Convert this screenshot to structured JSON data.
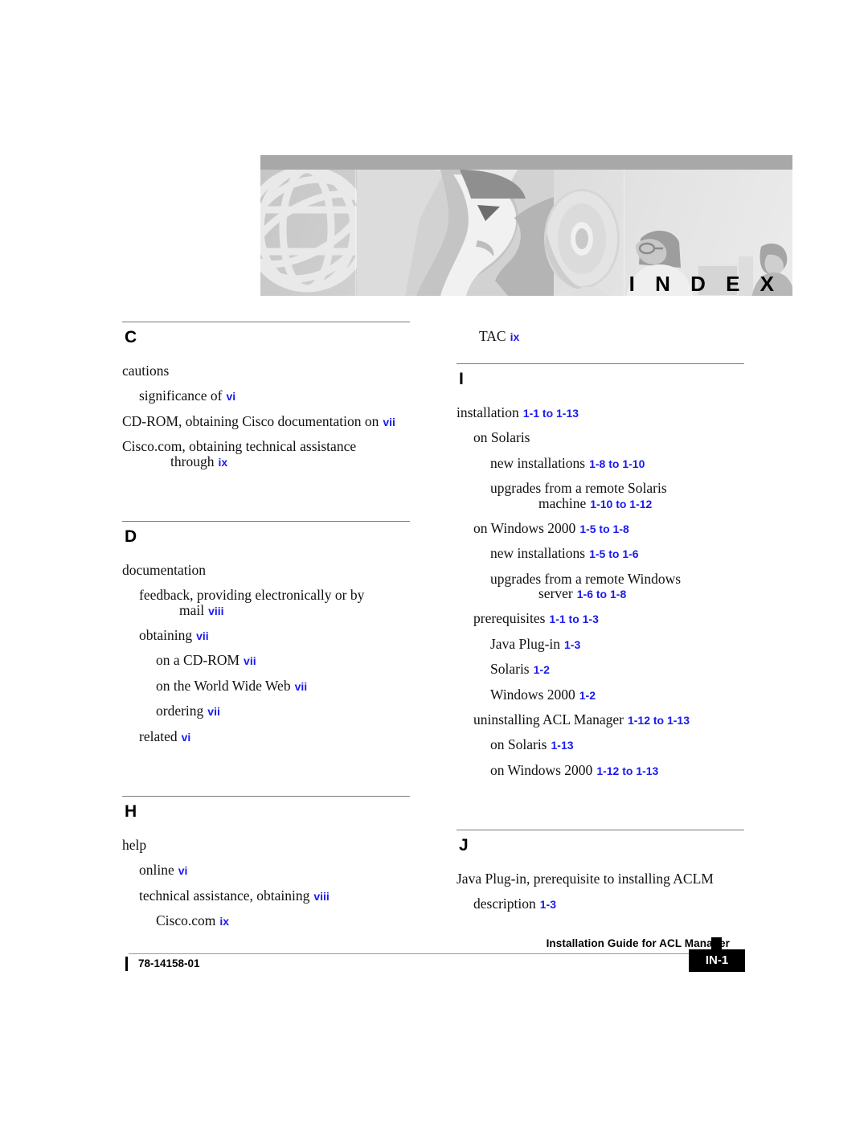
{
  "banner": {
    "title": "I N D E X",
    "icons": [
      "globe-wireframe",
      "stylized-face",
      "compact-disc",
      "people-at-monitor"
    ]
  },
  "orphan_entry": {
    "label": "TAC",
    "page": "ix"
  },
  "columns": {
    "left": [
      {
        "letter": "C",
        "entries": [
          {
            "level": 0,
            "text": "cautions",
            "page": ""
          },
          {
            "level": 1,
            "text": "significance of",
            "page": "vi"
          },
          {
            "level": 0,
            "text": "CD-ROM, obtaining Cisco documentation",
            "cont": "on",
            "page": "vii",
            "wrap": true
          },
          {
            "level": 0,
            "text": "Cisco.com, obtaining technical assistance",
            "cont": "through",
            "page": "ix",
            "wrap": true
          }
        ]
      },
      {
        "letter": "D",
        "entries": [
          {
            "level": 0,
            "text": "documentation",
            "page": ""
          },
          {
            "level": 1,
            "text": "feedback, providing electronically or by",
            "cont": "mail",
            "page": "viii",
            "wrap": true
          },
          {
            "level": 1,
            "text": "obtaining",
            "page": "vii"
          },
          {
            "level": 2,
            "text": "on a CD-ROM",
            "page": "vii"
          },
          {
            "level": 2,
            "text": "on the World Wide Web",
            "page": "vii"
          },
          {
            "level": 2,
            "text": "ordering",
            "page": "vii"
          },
          {
            "level": 1,
            "text": "related",
            "page": "vi"
          }
        ]
      },
      {
        "letter": "H",
        "entries": [
          {
            "level": 0,
            "text": "help",
            "page": ""
          },
          {
            "level": 1,
            "text": "online",
            "page": "vi"
          },
          {
            "level": 1,
            "text": "technical assistance, obtaining",
            "page": "viii"
          },
          {
            "level": 2,
            "text": "Cisco.com",
            "page": "ix"
          }
        ]
      }
    ],
    "right": [
      {
        "letter": "I",
        "entries": [
          {
            "level": 0,
            "text": "installation",
            "page": "1-1 to 1-13"
          },
          {
            "level": 1,
            "text": "on Solaris",
            "page": ""
          },
          {
            "level": 2,
            "text": "new installations",
            "page": "1-8 to 1-10"
          },
          {
            "level": 2,
            "text": "upgrades from a remote Solaris",
            "cont": "machine",
            "page": "1-10 to 1-12",
            "wrap": true
          },
          {
            "level": 1,
            "text": "on Windows 2000",
            "page": "1-5 to 1-8"
          },
          {
            "level": 2,
            "text": "new installations",
            "page": "1-5 to 1-6"
          },
          {
            "level": 2,
            "text": "upgrades from a remote Windows",
            "cont": "server",
            "page": "1-6 to 1-8",
            "wrap": true
          },
          {
            "level": 1,
            "text": "prerequisites",
            "page": "1-1 to 1-3"
          },
          {
            "level": 2,
            "text": "Java Plug-in",
            "page": "1-3"
          },
          {
            "level": 2,
            "text": "Solaris",
            "page": "1-2"
          },
          {
            "level": 2,
            "text": "Windows 2000",
            "page": "1-2"
          },
          {
            "level": 1,
            "text": "uninstalling ACL Manager",
            "page": "1-12 to 1-13"
          },
          {
            "level": 2,
            "text": "on Solaris",
            "page": "1-13"
          },
          {
            "level": 2,
            "text": "on Windows 2000",
            "page": "1-12 to 1-13"
          }
        ]
      },
      {
        "letter": "J",
        "entries": [
          {
            "level": 0,
            "text": "Java Plug-in, prerequisite to installing ACLM",
            "page": ""
          },
          {
            "level": 1,
            "text": "description",
            "page": "1-3"
          }
        ]
      }
    ]
  },
  "footer": {
    "guide_title": "Installation Guide for ACL Manager",
    "doc_number": "78-14158-01",
    "page_label": "IN-1"
  },
  "colors": {
    "page_ref_blue": "#1a1aee",
    "rule_gray": "#7a7a7a",
    "banner_bar": "#a8a8a8"
  }
}
